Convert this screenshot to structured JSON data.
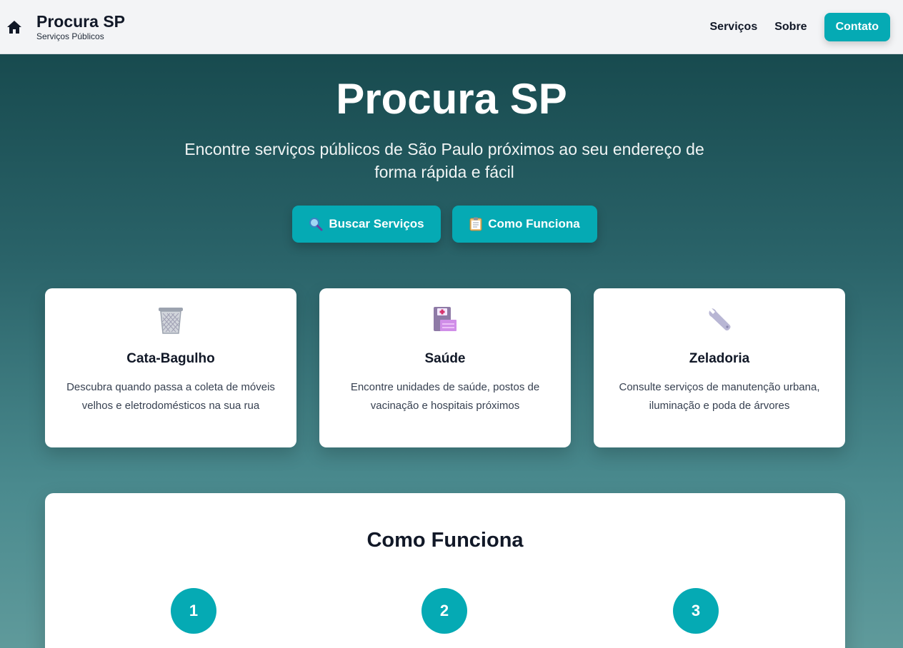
{
  "header": {
    "home_icon": "home-icon",
    "title": "Procura SP",
    "subtitle": "Serviços Públicos",
    "nav": {
      "services": "Serviços",
      "about": "Sobre",
      "contact": "Contato"
    }
  },
  "hero": {
    "title": "Procura SP",
    "subtitle": "Encontre serviços públicos de São Paulo próximos ao seu endereço de forma rápida e fácil",
    "buttons": {
      "search": {
        "label": "Buscar Serviços",
        "icon": "magnifier-icon"
      },
      "how": {
        "label": "Como Funciona",
        "icon": "clipboard-icon"
      }
    }
  },
  "cards": [
    {
      "icon": "wastebasket-icon",
      "title": "Cata-Bagulho",
      "description": "Descubra quando passa a coleta de móveis velhos e eletrodomésticos na sua rua"
    },
    {
      "icon": "hospital-icon",
      "title": "Saúde",
      "description": "Encontre unidades de saúde, postos de vacinação e hospitais próximos"
    },
    {
      "icon": "wrench-icon",
      "title": "Zeladoria",
      "description": "Consulte serviços de manutenção urbana, iluminação e poda de árvores"
    }
  ],
  "how_it_works": {
    "title": "Como Funciona",
    "steps": [
      "1",
      "2",
      "3"
    ]
  },
  "colors": {
    "accent": "#05aab4",
    "header_bg": "#f3f4f6",
    "hero_top": "#134448",
    "hero_bottom": "#5f9a9b"
  }
}
